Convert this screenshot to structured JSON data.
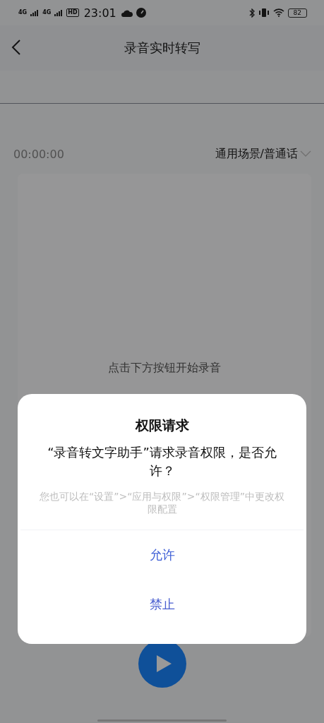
{
  "status_bar": {
    "signals": [
      "4G",
      "4G"
    ],
    "hd": "HD",
    "time": "23:01",
    "battery": "82"
  },
  "header": {
    "title": "录音实时转写"
  },
  "recorder": {
    "timer": "00:00:00",
    "scene": "通用场景/普通话",
    "hint": "点击下方按钮开始录音"
  },
  "dialog": {
    "title": "权限请求",
    "message": "“录音转文字助手”请求录音权限，是否允许？",
    "note": "您也可以在“设置”>“应用与权限”>“权限管理”中更改权限配置",
    "buttons": [
      {
        "label": "允许",
        "kind": "allow"
      },
      {
        "label": "禁止",
        "kind": "deny"
      }
    ]
  }
}
